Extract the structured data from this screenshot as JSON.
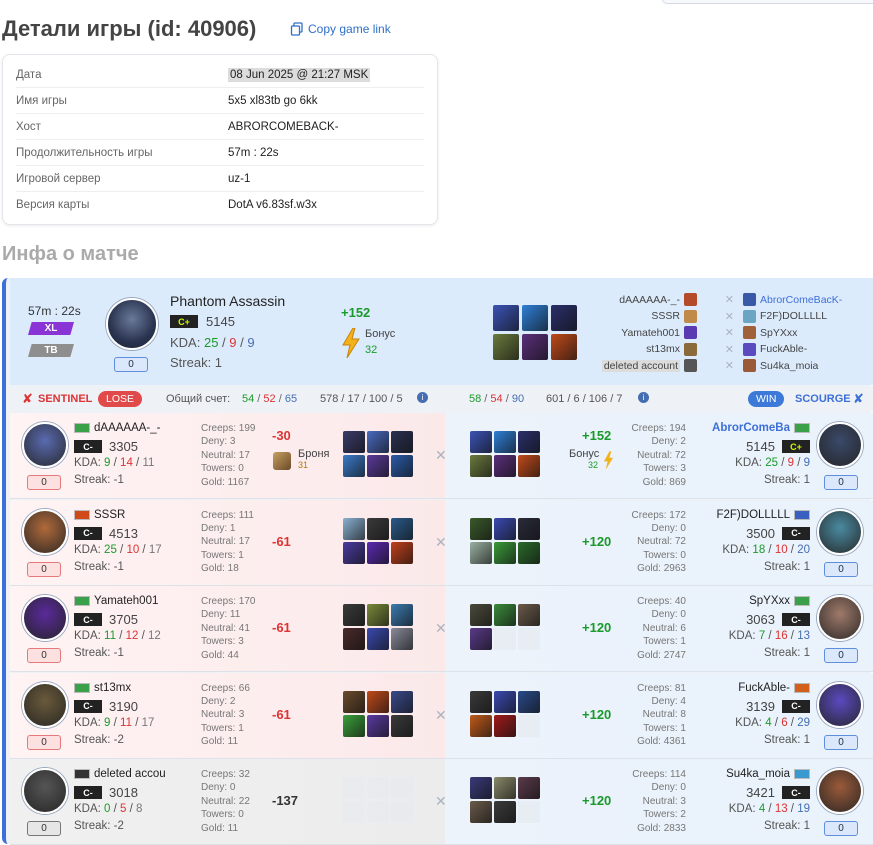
{
  "page": {
    "title": "Детали игры (id: 40906)",
    "copy_link": "Copy game link",
    "section_title": "Инфа о матче"
  },
  "info": [
    {
      "key": "Дата",
      "value": "08 Jun 2025 @ 21:27 MSK"
    },
    {
      "key": "Имя игры",
      "value": "5x5 xl83tb go 6kk"
    },
    {
      "key": "Хост",
      "value": "ABRORCOMEBACK-"
    },
    {
      "key": "Продолжительность игры",
      "value": "57m : 22s"
    },
    {
      "key": "Игровой сервер",
      "value": "uz-1"
    },
    {
      "key": "Версия карты",
      "value": "DotA v6.83sf.w3x"
    }
  ],
  "header": {
    "duration": "57m : 22s",
    "mode1": "XL",
    "mode2": "TB",
    "mvp_hero": "Phantom Assassin",
    "mvp_rank": "C+",
    "mvp_mmr": "5145",
    "kda_label": "KDA:",
    "k": "25",
    "d": "9",
    "a": "9",
    "streak": "Streak: 1",
    "score_badge": "0",
    "delta": "+152",
    "bonus_label": "Бонус",
    "bonus_value": "32",
    "item_colors": [
      "#3b53b5",
      "#2e7fd6",
      "#2a2f6a",
      "#6a7a3c",
      "#5a2e7a",
      "#c04a1a"
    ],
    "matchups": [
      {
        "left": "dAAAAAA-_-",
        "right": "AbrorComeBacK-",
        "lc": "#b44a2a",
        "rc": "#3a5aa8"
      },
      {
        "left": "SSSR",
        "right": "F2F)DOLLLLL",
        "lc": "#c08a4a",
        "rc": "#6aa6c4"
      },
      {
        "left": "Yamateh001",
        "right": "SpYXxx",
        "lc": "#5a3ab0",
        "rc": "#a0603a"
      },
      {
        "left": "st13mx",
        "right": "FuckAble-",
        "lc": "#8a6a3a",
        "rc": "#5a4ac0"
      },
      {
        "left": "deleted account",
        "right": "Su4ka_moia",
        "lc": "#555",
        "rc": "#9a5a3a"
      }
    ]
  },
  "teambar": {
    "sentinel": "SENTINEL",
    "lose": "LOSE",
    "total_label": "Общий счет:",
    "s_k": "54",
    "s_d": "52",
    "s_a": "65",
    "s_cs": "578 / 17 / 100 / 5",
    "c_k": "58",
    "c_d": "54",
    "c_a": "90",
    "c_cs": "601 / 6 / 106 / 7",
    "win": "WIN",
    "scourge": "SCOURGE"
  },
  "rows": [
    {
      "l": {
        "name": "dAAAAAA-_-",
        "rank": "C-",
        "mmr": "3305",
        "k": "9",
        "d": "14",
        "a": "11",
        "streak": "Streak: -1",
        "creeps": "Creeps: 199",
        "deny": "Deny: 3",
        "neutral": "Neutral: 17",
        "towers": "Towers: 0",
        "gold": "Gold: 1167",
        "delta": "-30",
        "armor": "Броня",
        "armor_v": "31",
        "av": "#5a6ab0",
        "flag": "#3aa04a",
        "items": [
          "#3a3a6a",
          "#4a6ac0",
          "#2a3050",
          "#3a7ac8",
          "#5a3a9a",
          "#2a5aa8"
        ]
      },
      "r": {
        "name": "AbrorComeBa",
        "rank": "C+",
        "mmr": "5145",
        "k": "25",
        "d": "9",
        "a": "9",
        "streak": "Streak: 1",
        "creeps": "Creeps: 194",
        "deny": "Deny: 2",
        "neutral": "Neutral: 72",
        "towers": "Towers: 3",
        "gold": "Gold: 869",
        "delta": "+152",
        "bonus": "Бонус",
        "bonus_v": "32",
        "av": "#3a4a6a",
        "flag": "#3aa04a",
        "items": [
          "#3b53b5",
          "#2e7fd6",
          "#2a2f6a",
          "#6a7a3c",
          "#5a2e7a",
          "#c04a1a"
        ]
      }
    },
    {
      "l": {
        "name": "SSSR",
        "rank": "C-",
        "mmr": "4513",
        "k": "25",
        "d": "10",
        "a": "17",
        "streak": "Streak: -1",
        "creeps": "Creeps: 111",
        "deny": "Deny: 1",
        "neutral": "Neutral: 17",
        "towers": "Towers: 1",
        "gold": "Gold: 18",
        "delta": "-61",
        "av": "#b06a3a",
        "flag": "#d04a1a",
        "items": [
          "#8ab0d0",
          "#3a3a3a",
          "#2a5a8a",
          "#4a3aa0",
          "#5a2ab0",
          "#c0401a"
        ]
      },
      "r": {
        "name": "F2F)DOLLLLL",
        "rank": "C-",
        "mmr": "3500",
        "k": "18",
        "d": "10",
        "a": "20",
        "streak": "Streak: 1",
        "creeps": "Creeps: 172",
        "deny": "Deny: 0",
        "neutral": "Neutral: 72",
        "towers": "Towers: 0",
        "gold": "Gold: 2963",
        "delta": "+120",
        "av": "#4a8aa0",
        "flag": "#3a60c0",
        "items": [
          "#3a5a2a",
          "#3a4ab0",
          "#2a2a3a",
          "#9ab0a0",
          "#3a9a3a",
          "#2a6a2a"
        ]
      }
    },
    {
      "l": {
        "name": "Yamateh001",
        "rank": "C-",
        "mmr": "3705",
        "k": "11",
        "d": "12",
        "a": "12",
        "streak": "Streak: -1",
        "creeps": "Creeps: 170",
        "deny": "Deny: 11",
        "neutral": "Neutral: 41",
        "towers": "Towers: 3",
        "gold": "Gold: 44",
        "delta": "-61",
        "av": "#5a2a9a",
        "flag": "#3aa04a",
        "items": [
          "#3a3a3a",
          "#7a8a3a",
          "#3a7ab0",
          "#4a2a2a",
          "#3a4ab0",
          "#8a8a9a"
        ]
      },
      "r": {
        "name": "SpYXxx",
        "rank": "C-",
        "mmr": "3063",
        "k": "7",
        "d": "16",
        "a": "13",
        "streak": "Streak: 1",
        "creeps": "Creeps: 40",
        "deny": "Deny: 0",
        "neutral": "Neutral: 6",
        "towers": "Towers: 1",
        "gold": "Gold: 2747",
        "delta": "+120",
        "av": "#a07a6a",
        "flag": "#3aa04a",
        "items": [
          "#4a4a3a",
          "#3a8a3a",
          "#6a5a4a",
          "#5a3a8a",
          "",
          ""
        ]
      }
    },
    {
      "l": {
        "name": "st13mx",
        "rank": "C-",
        "mmr": "3190",
        "k": "9",
        "d": "11",
        "a": "17",
        "streak": "Streak: -2",
        "creeps": "Creeps: 66",
        "deny": "Deny: 2",
        "neutral": "Neutral: 3",
        "towers": "Towers: 1",
        "gold": "Gold: 11",
        "delta": "-61",
        "av": "#6a5a3a",
        "flag": "#3aa04a",
        "items": [
          "#6a4a2a",
          "#c04a1a",
          "#3a4a8a",
          "#3aa03a",
          "#5a3aa0",
          "#3a3a3a"
        ]
      },
      "r": {
        "name": "FuckAble-",
        "rank": "C-",
        "mmr": "3139",
        "k": "4",
        "d": "6",
        "a": "29",
        "streak": "Streak: 1",
        "creeps": "Creeps: 81",
        "deny": "Deny: 4",
        "neutral": "Neutral: 8",
        "towers": "Towers: 1",
        "gold": "Gold: 4361",
        "delta": "+120",
        "av": "#5a4ac0",
        "flag": "#d0601a",
        "items": [
          "#3a3a3a",
          "#3a4ab0",
          "#2a4a8a",
          "#c05a1a",
          "#a01a1a",
          ""
        ]
      }
    },
    {
      "l": {
        "name": "deleted accou",
        "rank": "C-",
        "mmr": "3018",
        "k": "0",
        "d": "5",
        "a": "8",
        "streak": "Streak: -2",
        "creeps": "Creeps: 32",
        "deny": "Deny: 0",
        "neutral": "Neutral: 22",
        "towers": "Towers: 0",
        "gold": "Gold: 11",
        "delta": "-137",
        "av": "#555",
        "flag": "#333",
        "items": [
          "",
          "",
          "",
          "",
          "",
          ""
        ]
      },
      "r": {
        "name": "Su4ka_moia",
        "rank": "C-",
        "mmr": "3421",
        "k": "4",
        "d": "13",
        "a": "19",
        "streak": "Streak: 1",
        "creeps": "Creeps: 114",
        "deny": "Deny: 0",
        "neutral": "Neutral: 3",
        "towers": "Towers: 2",
        "gold": "Gold: 2833",
        "delta": "+120",
        "av": "#9a5a3a",
        "flag": "#3a9ad0",
        "items": [
          "#3a3a7a",
          "#8a8a6a",
          "#5a3a4a",
          "#6a5a4a",
          "#3a3a3a",
          ""
        ]
      }
    }
  ]
}
